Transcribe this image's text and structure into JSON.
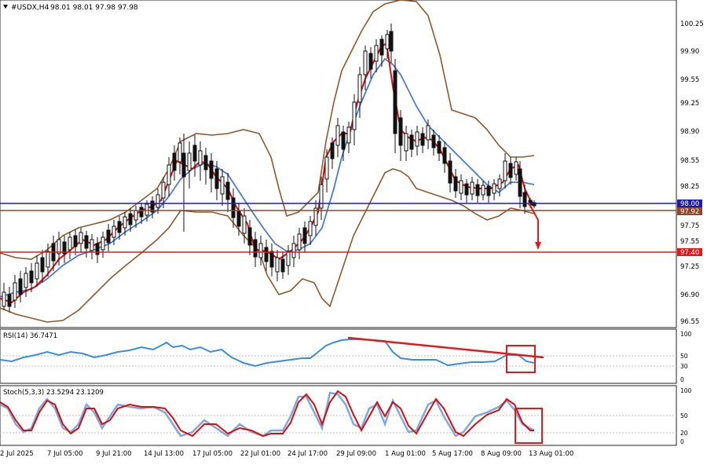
{
  "header": {
    "symbol_label": "#USDX,H4",
    "ohlc": "98.01 98.01 97.98 97.98",
    "arrow_icon": "caret-down-icon"
  },
  "price_axis": {
    "ticks": [
      "100.25",
      "99.90",
      "99.55",
      "99.25",
      "98.90",
      "98.55",
      "98.25",
      "97.75",
      "97.55",
      "97.25",
      "96.90",
      "96.55"
    ],
    "tags": {
      "current": "98.00",
      "support1": "97.92",
      "support2": "97.40"
    }
  },
  "rsi": {
    "label": "RSI(14) 36.7471",
    "ticks": [
      "100",
      "50",
      "30",
      "0"
    ]
  },
  "stoch": {
    "label": "Stoch(5,3,3) 23.5294 23.1209",
    "ticks": [
      "100",
      "50",
      "20",
      "0"
    ]
  },
  "time_axis": {
    "ticks": [
      "2 Jul 2025",
      "7 Jul 05:00",
      "9 Jul 21:00",
      "14 Jul 13:00",
      "17 Jul 05:00",
      "22 Jul 01:00",
      "24 Jul 17:00",
      "29 Jul 09:00",
      "1 Aug 01:00",
      "5 Aug 17:00",
      "8 Aug 09:00",
      "13 Aug 01:00"
    ]
  },
  "colors": {
    "price_line_blue": "#1e1ea0",
    "support_brown": "#8b4a2b",
    "support_red": "#e01b1b",
    "ma_blue": "#4a7bd0",
    "bollinger": "#8b5a2b",
    "rsi_line": "#3a8fdc",
    "stoch_main": "#d40f0f",
    "stoch_signal": "#7fa8e0",
    "annotation": "#e01b1b"
  }
}
